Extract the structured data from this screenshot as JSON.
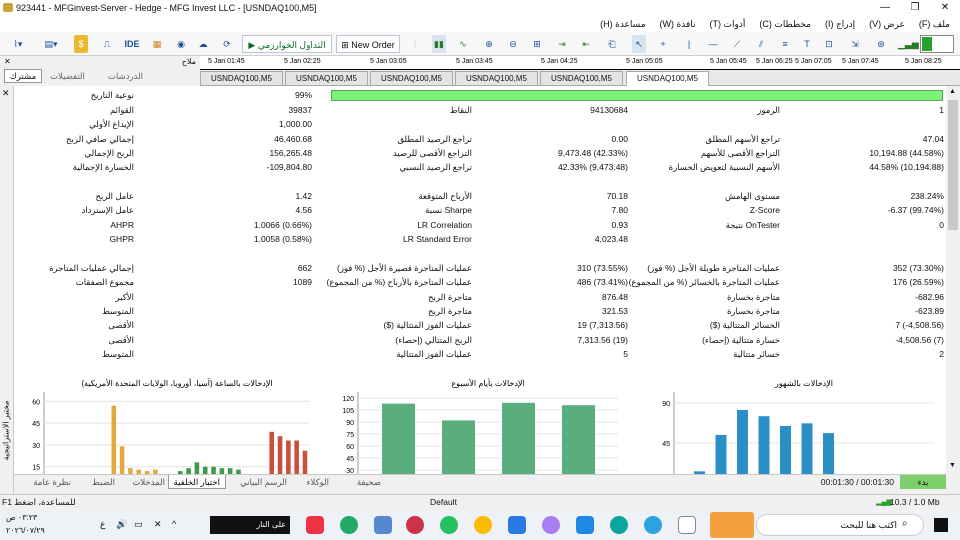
{
  "window": {
    "title": "923441 - MFGinvest-Server - Hedge - MFG Invest LLC - [USNDAQ100,M5]"
  },
  "menu": [
    "ملف (F)",
    "عرض (V)",
    "إدراج (I)",
    "مخططات (C)",
    "أدوات (T)",
    "نافذة (W)",
    "مساعدة (H)"
  ],
  "toolbar": {
    "ide": "IDE",
    "algo": "التداول الخوارزمي",
    "new_order": "New Order"
  },
  "panel": {
    "title": "ملاح",
    "tabs": [
      "الدردشات",
      "التفضيلات",
      "مشترك"
    ]
  },
  "timeline": [
    "5 Jan 01:45",
    "5 Jan 02:25",
    "5 Jan 03:05",
    "5 Jan 03:45",
    "5 Jan 04:25",
    "5 Jan 05:05",
    "5 Jan 05:45",
    "5 Jan 06:25",
    "5 Jan 07:05",
    "5 Jan 07:45",
    "5 Jan 08:25"
  ],
  "chart_tabs": [
    "USNDAQ100,M5",
    "USNDAQ100,M5",
    "USNDAQ100,M5",
    "USNDAQ100,M5",
    "USNDAQ100,M5",
    "USNDAQ100,M5"
  ],
  "report": {
    "history_quality_label": "نوعية التاريخ",
    "history_quality_value": "99%",
    "rows": [
      {
        "l1": "القوائم",
        "v1": "39837",
        "l2": "النقاط",
        "v2": "94130684",
        "l3": "الرموز",
        "v3": "1"
      },
      {
        "l1": "الإيداع الأولي",
        "v1": "1,000.00",
        "l2": "",
        "v2": "",
        "l3": "",
        "v3": ""
      },
      {
        "l1": "إجمالي صافي الربح",
        "v1": "46,460.68",
        "l2": "تراجع الرصيد المطلق",
        "v2": "0.00",
        "l3": "تراجع الأسهم المطلق",
        "v3": "47.04"
      },
      {
        "l1": "الربح الإجمالي",
        "v1": "156,265.48",
        "l2": "التراجع الأقصى للرصيد",
        "v2": "9,473.48 (42.33%)",
        "l3": "التراجع الأقصى للأسهم",
        "v3": "10,194.88 (44.58%)"
      },
      {
        "l1": "الخسارة الإجمالية",
        "v1": "-109,804.80",
        "l2": "تراجع الرصيد النسبي",
        "v2": "42.33% (9,473.48)",
        "l3": "الأسهم النسبية لتعويض الخسارة",
        "v3": "44.58% (10,194.88)"
      },
      {
        "l1": "",
        "v1": "",
        "l2": "",
        "v2": "",
        "l3": "",
        "v3": ""
      },
      {
        "l1": "عامل الربح",
        "v1": "1.42",
        "l2": "الأرباح المتوقعة",
        "v2": "70.18",
        "l3": "مستوى الهامش",
        "v3": "238.24%"
      },
      {
        "l1": "عامل الإسترداد",
        "v1": "4.56",
        "l2": "Sharpe نسبة",
        "v2": "7.80",
        "l3": "Z-Score",
        "v3": "-6.37 (99.74%)"
      },
      {
        "l1": "AHPR",
        "v1": "1.0066 (0.66%)",
        "l2": "LR Correlation",
        "v2": "0.93",
        "l3": "OnTester نتيجة",
        "v3": "0"
      },
      {
        "l1": "GHPR",
        "v1": "1.0058 (0.58%)",
        "l2": "LR Standard Error",
        "v2": "4,023.48",
        "l3": "",
        "v3": ""
      },
      {
        "l1": "",
        "v1": "",
        "l2": "",
        "v2": "",
        "l3": "",
        "v3": ""
      },
      {
        "l1": "إجمالي عمليات المتاجرة",
        "v1": "662",
        "l2": "عمليات المتاجرة قصيرة الأجل (% فوز)",
        "v2": "310 (73.55%)",
        "l3": "عمليات المتاجرة طويلة الأجل (% فوز)",
        "v3": "352 (73.30%)"
      },
      {
        "l1": "مجموع الصفقات",
        "v1": "1089",
        "l2": "عمليات المتاجرة بالأرباح (% من المجموع)",
        "v2": "486 (73.41%)",
        "l3": "عمليات المتاجرة بالخسائر (% من المجموع)",
        "v3": "176 (26.59%)"
      },
      {
        "l1": "الأكبر",
        "v1": "",
        "l2": "متاجرة الربح",
        "v2": "876.48",
        "l3": "متاجرة بخسارة",
        "v3": "-682.96"
      },
      {
        "l1": "المتوسط",
        "v1": "",
        "l2": "متاجرة الربح",
        "v2": "321.53",
        "l3": "متاجرة بخسارة",
        "v3": "-623.89"
      },
      {
        "l1": "الأقصى",
        "v1": "",
        "l2": "عمليات الفوز المتتالية ($)",
        "v2": "19 (7,313.56)",
        "l3": "الخسائر المتتالية ($)",
        "v3": "7 (-4,508.56)"
      },
      {
        "l1": "الأقصى",
        "v1": "",
        "l2": "الربح المتتالي (إحصاء)",
        "v2": "7,313.56 (19)",
        "l3": "خسارة متتالية (إحصاء)",
        "v3": "-4,508.56 (7)"
      },
      {
        "l1": "المتوسط",
        "v1": "",
        "l2": "عمليات الفوز المتتالية",
        "v2": "5",
        "l3": "خسائر متتالية",
        "v3": "2"
      }
    ]
  },
  "chart_data": [
    {
      "type": "bar",
      "title": "الإدخالات بالساعة (آسيا، أوروبا، الولايات المتحدة الأمريكية)",
      "yticks": [
        60,
        45,
        30,
        15
      ],
      "ylim": [
        10,
        65
      ],
      "series": [
        {
          "color": "#d4a020",
          "values": [
            0,
            0,
            0,
            0,
            0,
            0,
            0,
            0,
            57,
            28,
            0,
            0,
            0,
            0,
            0,
            0,
            0,
            0,
            0,
            0,
            0,
            0,
            0,
            0,
            0,
            0,
            0,
            0,
            0,
            0,
            0,
            0
          ]
        },
        {
          "color": "#2e8b3c",
          "values": [
            0,
            0,
            0,
            0,
            0,
            0,
            0,
            0,
            0,
            0,
            0,
            0,
            0,
            0,
            0,
            0,
            0,
            0,
            0,
            14,
            13,
            0,
            0,
            0,
            0,
            0,
            0,
            0,
            0,
            0,
            0,
            0
          ]
        },
        {
          "color": "#c8503c",
          "values": [
            0,
            0,
            0,
            0,
            0,
            0,
            0,
            0,
            0,
            0,
            0,
            0,
            0,
            0,
            0,
            0,
            0,
            0,
            0,
            0,
            0,
            0,
            0,
            0,
            0,
            0,
            0,
            0,
            0,
            0,
            0,
            0
          ]
        }
      ],
      "bars": [
        {
          "x": 8,
          "v": 57,
          "c": "#e3a93a"
        },
        {
          "x": 9,
          "v": 29,
          "c": "#e3a93a"
        },
        {
          "x": 10,
          "v": 14,
          "c": "#e3a93a"
        },
        {
          "x": 11,
          "v": 13,
          "c": "#e3a93a"
        },
        {
          "x": 12,
          "v": 12,
          "c": "#e3a93a"
        },
        {
          "x": 13,
          "v": 13,
          "c": "#e3a93a"
        },
        {
          "x": 16,
          "v": 12,
          "c": "#3c9a4a"
        },
        {
          "x": 17,
          "v": 14,
          "c": "#3c9a4a"
        },
        {
          "x": 18,
          "v": 18,
          "c": "#3c9a4a"
        },
        {
          "x": 19,
          "v": 15,
          "c": "#3c9a4a"
        },
        {
          "x": 20,
          "v": 15,
          "c": "#3c9a4a"
        },
        {
          "x": 21,
          "v": 14,
          "c": "#3c9a4a"
        },
        {
          "x": 22,
          "v": 14,
          "c": "#3c9a4a"
        },
        {
          "x": 23,
          "v": 13,
          "c": "#3c9a4a"
        },
        {
          "x": 27,
          "v": 39,
          "c": "#c8503c"
        },
        {
          "x": 28,
          "v": 36,
          "c": "#c8503c"
        },
        {
          "x": 29,
          "v": 33,
          "c": "#c8503c"
        },
        {
          "x": 30,
          "v": 33,
          "c": "#c8503c"
        },
        {
          "x": 31,
          "v": 26,
          "c": "#c8503c"
        }
      ]
    },
    {
      "type": "bar",
      "title": "الإدخالات بأيام الأسبوع",
      "yticks": [
        120,
        105,
        90,
        75,
        60,
        45,
        30
      ],
      "ylim": [
        25,
        125
      ],
      "color": "#5aae7e",
      "values": [
        113,
        92,
        114,
        111
      ]
    },
    {
      "type": "bar",
      "title": "الإدخالات بالشهور",
      "yticks": [
        90,
        45
      ],
      "ylim": [
        10,
        100
      ],
      "color": "#2a8fc4",
      "values": [
        13,
        54,
        82,
        75,
        64,
        67,
        56
      ]
    }
  ],
  "bottom_tabs": [
    "نظرة عامة",
    "الضبط",
    "المدخلات",
    "اختبار الخلفية",
    "الرسم البياني",
    "الوكلاء",
    "صحيفة"
  ],
  "tester": {
    "timer": "00:01:30 / 00:01:30",
    "start": "بدء"
  },
  "status": {
    "help": "F1 للمساعدة، اضغط",
    "profile": "Default",
    "speed": "10.3 / 1.0 Mb"
  },
  "side_label": "مختبر الاستراتيجية",
  "taskbar": {
    "search": "اكتب هنا للبحث",
    "time": "٠٣:٢٣ ص",
    "date": "٢٠٢٦/٠٧/٢٩",
    "weather": "على النار"
  }
}
